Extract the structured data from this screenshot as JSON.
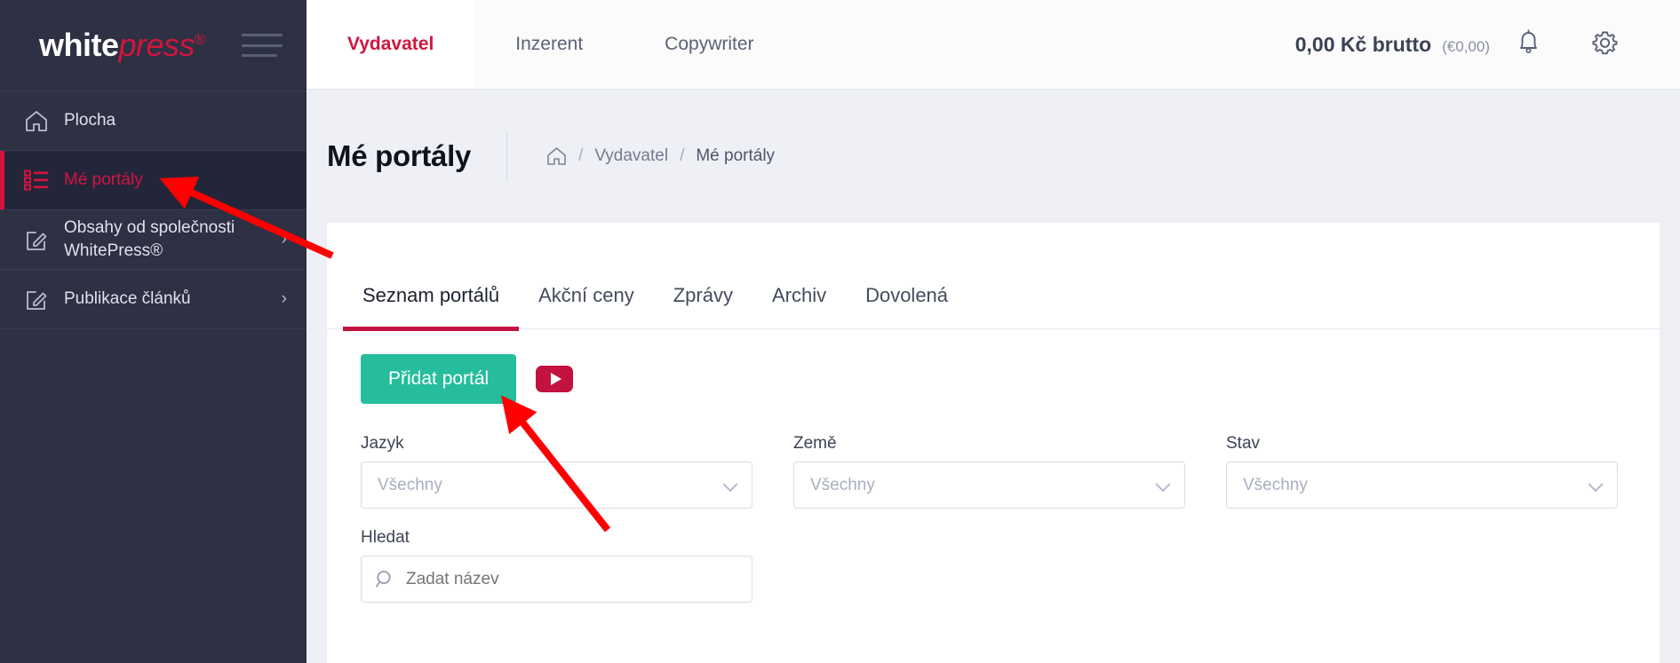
{
  "brand": {
    "logo_white": "white",
    "logo_press": "press",
    "logo_reg": "®"
  },
  "colors": {
    "accent_red": "#cf163f",
    "sidebar_bg": "#2e3043",
    "sidebar_active_bg": "#23263a",
    "primary_green": "#25bd9c",
    "tab_underline": "#c2123f",
    "annotation_arrow": "#ff0000"
  },
  "sidebar": {
    "items": [
      {
        "label": "Plocha",
        "icon": "home-icon",
        "active": false,
        "expandable": false
      },
      {
        "label": "Mé portály",
        "icon": "list-icon",
        "active": true,
        "expandable": false
      },
      {
        "label": "Obsahy od společnosti WhitePress®",
        "icon": "edit-square-icon",
        "active": false,
        "expandable": true,
        "chevron": "›"
      },
      {
        "label": "Publikace článků",
        "icon": "edit-square-icon",
        "active": false,
        "expandable": true,
        "chevron": "›"
      }
    ]
  },
  "topbar": {
    "tabs": [
      {
        "label": "Vydavatel",
        "active": true
      },
      {
        "label": "Inzerent",
        "active": false
      },
      {
        "label": "Copywriter",
        "active": false
      }
    ],
    "balance": "0,00 Kč brutto",
    "balance_secondary": "(€0,00)",
    "notification_icon": "bell-icon",
    "settings_icon": "gear-icon"
  },
  "page": {
    "title": "Mé portály",
    "breadcrumb": {
      "home_icon": "home-icon",
      "items": [
        {
          "label": "Vydavatel",
          "current": false
        },
        {
          "label": "Mé portály",
          "current": true
        }
      ],
      "separator": "/"
    }
  },
  "card": {
    "tabs": [
      {
        "label": "Seznam portálů",
        "active": true
      },
      {
        "label": "Akční ceny",
        "active": false
      },
      {
        "label": "Zprávy",
        "active": false
      },
      {
        "label": "Archiv",
        "active": false
      },
      {
        "label": "Dovolená",
        "active": false
      }
    ],
    "add_portal_button": "Přidat portál",
    "video_button_icon": "youtube-play-icon",
    "filters": [
      {
        "label": "Jazyk",
        "value": "Všechny",
        "type": "select",
        "name": "language"
      },
      {
        "label": "Země",
        "value": "Všechny",
        "type": "select",
        "name": "country"
      },
      {
        "label": "Stav",
        "value": "Všechny",
        "type": "select",
        "name": "state"
      }
    ],
    "search": {
      "label": "Hledat",
      "placeholder": "Zadat název",
      "value": "",
      "icon": "search-icon"
    }
  }
}
